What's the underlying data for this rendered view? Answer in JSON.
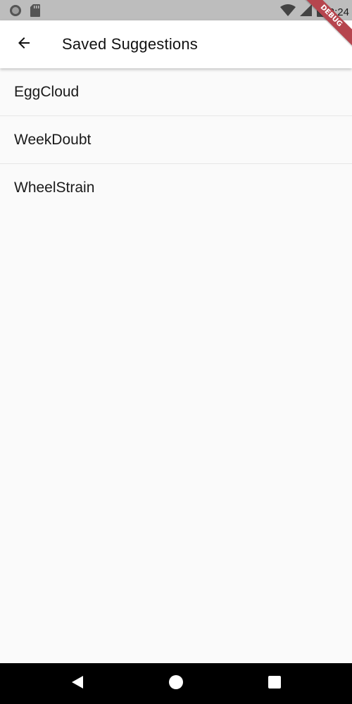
{
  "status_bar": {
    "time": "2:24",
    "icons": [
      "circle-indicator-icon",
      "sd-card-icon",
      "wifi-icon",
      "cell-signal-icon",
      "battery-icon"
    ]
  },
  "app_bar": {
    "title": "Saved Suggestions",
    "back_icon": "arrow-back-icon"
  },
  "debug_banner": {
    "label": "DEBUG"
  },
  "saved_list": {
    "items": [
      {
        "label": "EggCloud"
      },
      {
        "label": "WeekDoubt"
      },
      {
        "label": "WheelStrain"
      }
    ]
  },
  "nav_bar": {
    "buttons": [
      "back-triangle-icon",
      "home-circle-icon",
      "recents-square-icon"
    ]
  },
  "colors": {
    "status_bar_bg": "#bdbdbd",
    "app_bar_bg": "#ffffff",
    "page_bg": "#fafafa",
    "nav_bar_bg": "#000000",
    "debug_banner_bg": "#b6454e"
  }
}
